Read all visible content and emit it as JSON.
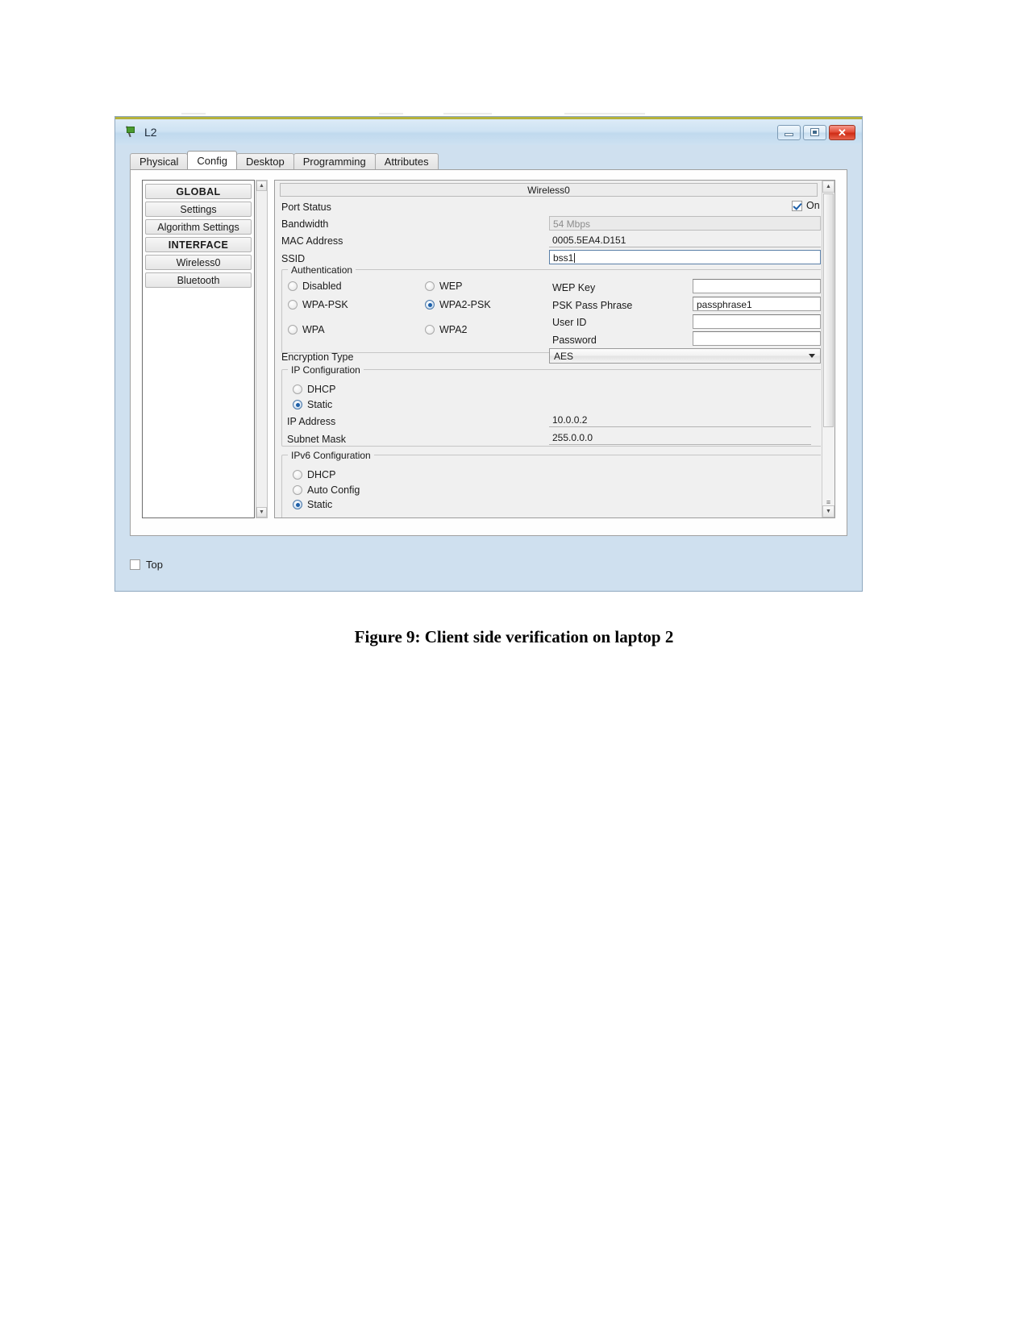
{
  "window": {
    "title": "L2",
    "icon": "node-flag-icon",
    "buttons": {
      "minimize": "–",
      "maximize": "□",
      "close": "✕"
    }
  },
  "tabs": [
    {
      "label": "Physical",
      "active": false
    },
    {
      "label": "Config",
      "active": true
    },
    {
      "label": "Desktop",
      "active": false
    },
    {
      "label": "Programming",
      "active": false
    },
    {
      "label": "Attributes",
      "active": false
    }
  ],
  "sidebar": {
    "items": [
      {
        "label": "GLOBAL",
        "kind": "section"
      },
      {
        "label": "Settings",
        "kind": "item"
      },
      {
        "label": "Algorithm Settings",
        "kind": "item"
      },
      {
        "label": "INTERFACE",
        "kind": "section"
      },
      {
        "label": "Wireless0",
        "kind": "item"
      },
      {
        "label": "Bluetooth",
        "kind": "item"
      }
    ]
  },
  "panel": {
    "interface_title": "Wireless0",
    "port_status": {
      "label": "Port Status",
      "checkbox_label": "On",
      "checked": true
    },
    "bandwidth": {
      "label": "Bandwidth",
      "value": "54 Mbps",
      "disabled": true
    },
    "mac_address": {
      "label": "MAC Address",
      "value": "0005.5EA4.D151"
    },
    "ssid": {
      "label": "SSID",
      "value": "bss1"
    },
    "authentication": {
      "title": "Authentication",
      "options": [
        {
          "label": "Disabled",
          "selected": false
        },
        {
          "label": "WEP",
          "selected": false
        },
        {
          "label": "WPA-PSK",
          "selected": false
        },
        {
          "label": "WPA2-PSK",
          "selected": true
        },
        {
          "label": "WPA",
          "selected": false
        },
        {
          "label": "WPA2",
          "selected": false
        }
      ],
      "fields": [
        {
          "label": "WEP Key",
          "value": ""
        },
        {
          "label": "PSK Pass Phrase",
          "value": "passphrase1"
        },
        {
          "label": "User ID",
          "value": ""
        },
        {
          "label": "Password",
          "value": ""
        }
      ]
    },
    "encryption_type": {
      "label": "Encryption Type",
      "value": "AES"
    },
    "ip_configuration": {
      "title": "IP Configuration",
      "modes": [
        {
          "label": "DHCP",
          "selected": false
        },
        {
          "label": "Static",
          "selected": true
        }
      ],
      "ip_address": {
        "label": "IP Address",
        "value": "10.0.0.2"
      },
      "subnet_mask": {
        "label": "Subnet Mask",
        "value": "255.0.0.0"
      }
    },
    "ipv6_configuration": {
      "title": "IPv6 Configuration",
      "modes": [
        {
          "label": "DHCP",
          "selected": false
        },
        {
          "label": "Auto Config",
          "selected": false
        },
        {
          "label": "Static",
          "selected": true
        }
      ]
    }
  },
  "bottom": {
    "top_checkbox_label": "Top",
    "checked": false
  },
  "caption": "Figure 9: Client side verification on laptop 2",
  "colors": {
    "titlebar": "#cfe3f3",
    "accent": "#1d5fa8",
    "close_button": "#cf2d16",
    "top_stripe": "#b5b23c"
  }
}
